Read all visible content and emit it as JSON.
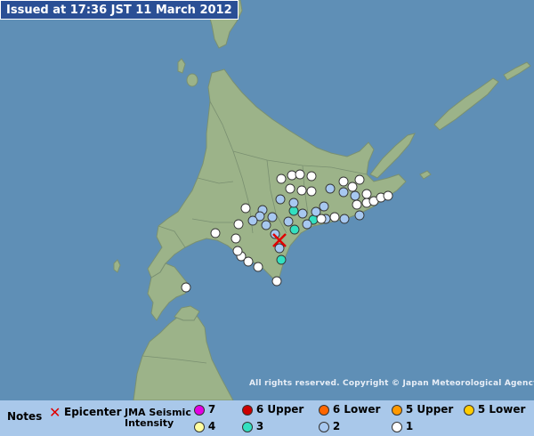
{
  "header": {
    "issued": "Issued at 17:36 JST  11 March 2012"
  },
  "map": {
    "copyright": "All rights reserved. Copyright © Japan Meteorological Agency",
    "colors": {
      "sea": "#5f8fb6",
      "land": "#9cb389",
      "border": "#7a9071",
      "epicenter": "#e00000"
    },
    "epicenter_icon": "x-mark-icon"
  },
  "legend": {
    "notes_label": "Notes",
    "epicenter_label": "Epicenter",
    "intensity_label_line1": "JMA Seismic",
    "intensity_label_line2": "Intensity",
    "items": [
      {
        "label": "7",
        "color": "#e400e4"
      },
      {
        "label": "6 Upper",
        "color": "#cc0000"
      },
      {
        "label": "6 Lower",
        "color": "#ff6600"
      },
      {
        "label": "5 Upper",
        "color": "#ff9900"
      },
      {
        "label": "5 Lower",
        "color": "#ffcc00"
      },
      {
        "label": "4",
        "color": "#ffffa0"
      },
      {
        "label": "3",
        "color": "#33e0c0"
      },
      {
        "label": "2",
        "color": "#a7c8f0"
      },
      {
        "label": "1",
        "color": "#ffffff"
      }
    ]
  },
  "stations": [
    {
      "intensity": "3"
    },
    {
      "intensity": "3"
    },
    {
      "intensity": "3"
    },
    {
      "intensity": "3"
    },
    {
      "intensity": "2"
    },
    {
      "intensity": "2"
    },
    {
      "intensity": "2"
    },
    {
      "intensity": "2"
    },
    {
      "intensity": "2"
    },
    {
      "intensity": "2"
    },
    {
      "intensity": "2"
    },
    {
      "intensity": "2"
    },
    {
      "intensity": "2"
    },
    {
      "intensity": "2"
    },
    {
      "intensity": "2"
    },
    {
      "intensity": "2"
    },
    {
      "intensity": "2"
    },
    {
      "intensity": "2"
    },
    {
      "intensity": "2"
    },
    {
      "intensity": "2"
    },
    {
      "intensity": "2"
    },
    {
      "intensity": "2"
    },
    {
      "intensity": "2"
    },
    {
      "intensity": "2"
    },
    {
      "intensity": "1"
    },
    {
      "intensity": "1"
    },
    {
      "intensity": "1"
    },
    {
      "intensity": "1"
    },
    {
      "intensity": "1"
    },
    {
      "intensity": "1"
    },
    {
      "intensity": "1"
    },
    {
      "intensity": "1"
    },
    {
      "intensity": "1"
    },
    {
      "intensity": "1"
    },
    {
      "intensity": "1"
    },
    {
      "intensity": "1"
    },
    {
      "intensity": "1"
    },
    {
      "intensity": "1"
    },
    {
      "intensity": "1"
    },
    {
      "intensity": "1"
    },
    {
      "intensity": "1"
    },
    {
      "intensity": "1"
    },
    {
      "intensity": "1"
    },
    {
      "intensity": "1"
    },
    {
      "intensity": "1"
    },
    {
      "intensity": "1"
    },
    {
      "intensity": "1"
    },
    {
      "intensity": "1"
    },
    {
      "intensity": "1"
    },
    {
      "intensity": "1"
    },
    {
      "intensity": "1"
    },
    {
      "intensity": "1"
    }
  ]
}
